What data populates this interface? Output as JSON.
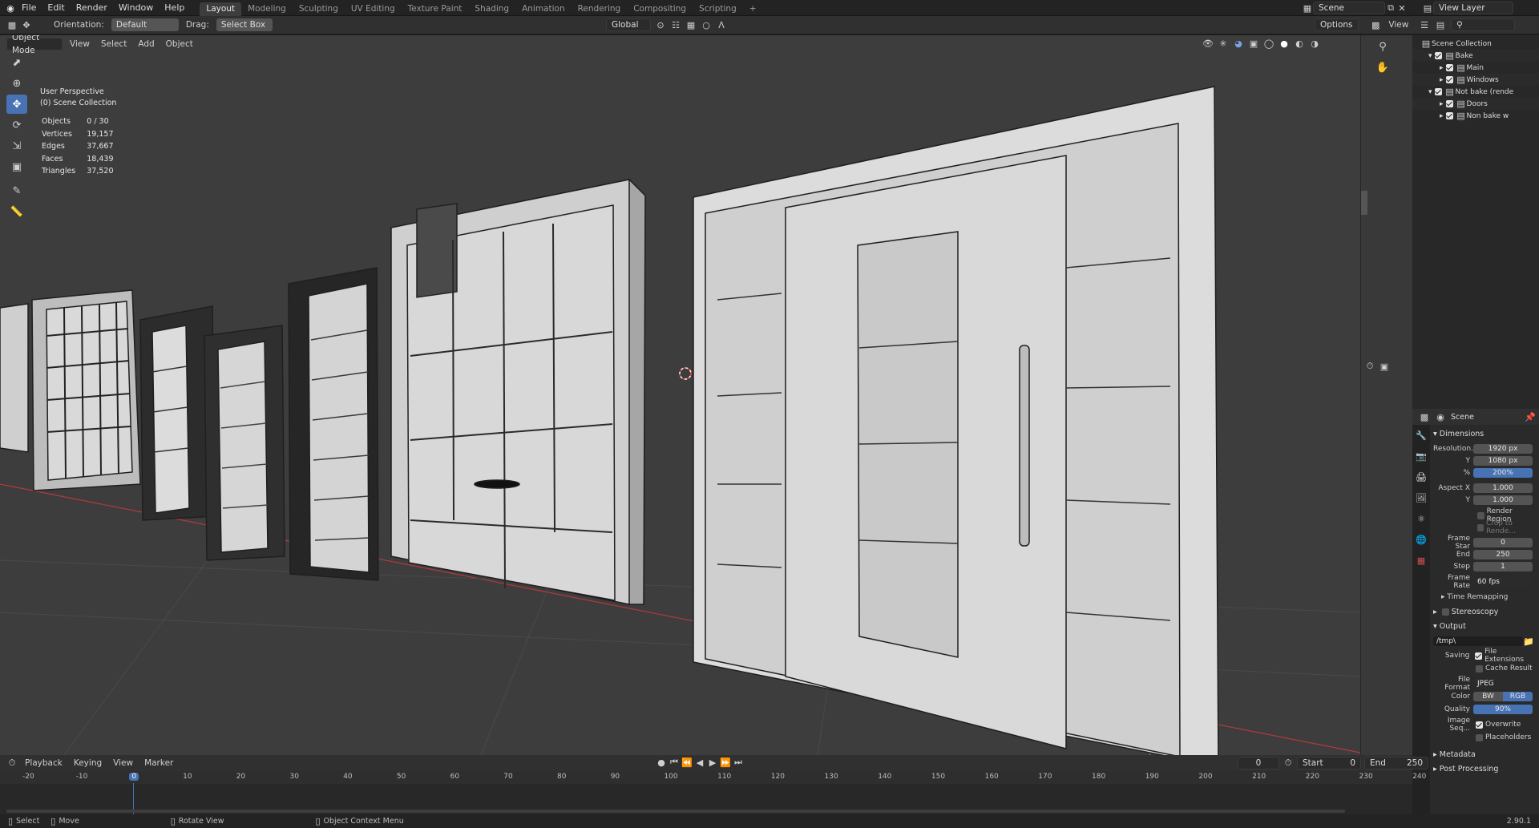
{
  "menu": [
    "File",
    "Edit",
    "Render",
    "Window",
    "Help"
  ],
  "workspaces": [
    {
      "label": "Layout",
      "active": true
    },
    {
      "label": "Modeling"
    },
    {
      "label": "Sculpting"
    },
    {
      "label": "UV Editing"
    },
    {
      "label": "Texture Paint"
    },
    {
      "label": "Shading"
    },
    {
      "label": "Animation"
    },
    {
      "label": "Rendering"
    },
    {
      "label": "Compositing"
    },
    {
      "label": "Scripting"
    }
  ],
  "topright": {
    "scene": "Scene",
    "view_layer": "View Layer"
  },
  "toolheader": {
    "orientation_label": "Orientation:",
    "orientation_value": "Default",
    "drag_label": "Drag:",
    "drag_value": "Select Box",
    "transform": "Global",
    "options": "Options"
  },
  "viewport_header": {
    "mode": "Object Mode",
    "menus": [
      "View",
      "Select",
      "Add",
      "Object"
    ]
  },
  "overlay": {
    "perspective": "User Perspective",
    "collection": "(0) Scene Collection",
    "stats": [
      {
        "k": "Objects",
        "v": "0 / 30"
      },
      {
        "k": "Vertices",
        "v": "19,157"
      },
      {
        "k": "Edges",
        "v": "37,667"
      },
      {
        "k": "Faces",
        "v": "18,439"
      },
      {
        "k": "Triangles",
        "v": "37,520"
      }
    ]
  },
  "outliner": {
    "view": "View",
    "items": [
      {
        "label": "Scene Collection"
      },
      {
        "label": "Bake"
      },
      {
        "label": "Main"
      },
      {
        "label": "Windows"
      },
      {
        "label": "Not bake (rende"
      },
      {
        "label": "Doors"
      },
      {
        "label": "Non bake w"
      }
    ]
  },
  "properties": {
    "context": "Scene",
    "dimensions": "Dimensions",
    "res_label": "Resolution...",
    "res_x": "1920 px",
    "y_label": "Y",
    "res_y": "1080 px",
    "pct_label": "%",
    "pct": "200%",
    "aspect_label": "Aspect X",
    "aspect_x": "1.000",
    "aspect_y": "1.000",
    "render_region": "Render Region",
    "crop": "Crop to Rende...",
    "frame_start_label": "Frame Star",
    "frame_start": "0",
    "end_label": "End",
    "frame_end": "250",
    "step_label": "Step",
    "step": "1",
    "frame_rate_label": "Frame Rate",
    "frame_rate": "60 fps",
    "time_remap": "Time Remapping",
    "stereo": "Stereoscopy",
    "output": "Output",
    "path": "/tmp\\",
    "saving_label": "Saving",
    "file_ext": "File Extensions",
    "cache": "Cache Result",
    "format_label": "File Format",
    "format": "JPEG",
    "color_label": "Color",
    "bw": "BW",
    "rgb": "RGB",
    "quality_label": "Quality",
    "quality": "90%",
    "imgseq_label": "Image Seq...",
    "overwrite": "Overwrite",
    "placeholders": "Placeholders",
    "metadata": "Metadata",
    "post": "Post Processing"
  },
  "timeline": {
    "menus": [
      "Playback",
      "Keying",
      "View",
      "Marker"
    ],
    "current": "0",
    "start_label": "Start",
    "start": "0",
    "end_label": "End",
    "end": "250",
    "ticks": [
      "-20",
      "-10",
      "0",
      "10",
      "20",
      "30",
      "40",
      "50",
      "60",
      "70",
      "80",
      "90",
      "100",
      "110",
      "120",
      "130",
      "140",
      "150",
      "160",
      "170",
      "180",
      "190",
      "200",
      "210",
      "220",
      "230",
      "240"
    ]
  },
  "status": {
    "select": "Select",
    "move": "Move",
    "rotate": "Rotate View",
    "context": "Object Context Menu",
    "version": "2.90.1"
  },
  "colors": {
    "accent": "#4772b3",
    "viewport": "#3d3d3d",
    "x_axis": "#b33a3a",
    "y_axis": "#6a9a2a"
  }
}
